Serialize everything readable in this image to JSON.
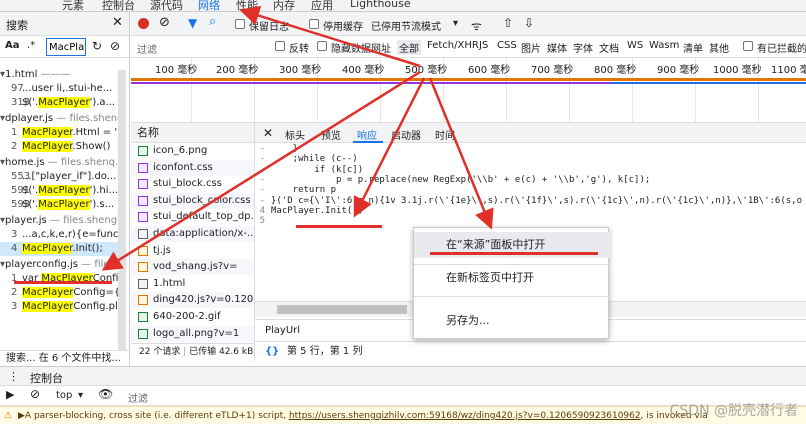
{
  "top_tabs": [
    "元素",
    "控制台",
    "源代码",
    "网络",
    "性能",
    "内存",
    "应用",
    "Lighthouse"
  ],
  "search": {
    "title": "搜索",
    "aa": "Aa",
    "regex": ".*",
    "query": "MacPlay",
    "results": [
      {
        "type": "file",
        "name": "1.html",
        "sub": "———"
      },
      {
        "type": "hit",
        "line": "97",
        "pre": "...user li,.stui-he..."
      },
      {
        "type": "hit",
        "line": "313",
        "pre": "$('.",
        "hl": "MacPlayer",
        "post": "').a..."
      },
      {
        "type": "file",
        "name": "dplayer.js",
        "sub": "— files.shenq..."
      },
      {
        "type": "hit",
        "line": "1",
        "hl": "MacPlayer",
        "post": ".Html = '..."
      },
      {
        "type": "hit",
        "line": "2",
        "hl": "MacPlayer",
        "post": ".Show()"
      },
      {
        "type": "file",
        "name": "home.js",
        "sub": "— files.shenq..."
      },
      {
        "type": "hit",
        "line": "553",
        "pre": "...[\"player_if\"].do..."
      },
      {
        "type": "hit",
        "line": "591",
        "pre": "$('.",
        "hl": "MacPlayer",
        "post": "').hi..."
      },
      {
        "type": "hit",
        "line": "593",
        "pre": "$('.",
        "hl": "MacPlayer",
        "post": "').s..."
      },
      {
        "type": "file",
        "name": "player.js",
        "sub": "— files.sheng..."
      },
      {
        "type": "hit",
        "line": "3",
        "pre": "...a,c,k,e,r){e=functi..."
      },
      {
        "type": "hit",
        "line": "4",
        "hl": "MacPlayer",
        "post": ".Init();",
        "selected": true
      },
      {
        "type": "file",
        "name": "playerconfig.js",
        "sub": "— files..."
      },
      {
        "type": "hit",
        "line": "1",
        "pre": "var ",
        "hl": "MacPlayer",
        "post": "Confi..."
      },
      {
        "type": "hit",
        "line": "2",
        "hl": "MacPlayer",
        "post": "Config={..."
      },
      {
        "type": "hit",
        "line": "3",
        "hl": "MacPlayer",
        "post": "Config.pl..."
      }
    ],
    "footer": "搜索...  在 6 个文件中找..."
  },
  "network_toolbar": {
    "preserve_log": "保留日志",
    "disable_cache": "停用缓存",
    "throttle": "已停用节流模式",
    "filter_placeholder": "过滤",
    "invert": "反转",
    "hide_data_urls": "隐藏数据网址",
    "types": [
      "全部",
      "Fetch/XHR",
      "JS",
      "CSS",
      "图片",
      "媒体",
      "字体",
      "文档",
      "WS",
      "Wasm",
      "清单",
      "其他"
    ],
    "blocked_cookies": "有已拦截的"
  },
  "timeline": {
    "ticks": [
      "100 毫秒",
      "200 毫秒",
      "300 毫秒",
      "400 毫秒",
      "500 毫秒",
      "600 毫秒",
      "700 毫秒",
      "800 毫秒",
      "900 毫秒",
      "1000 毫秒",
      "1100 毫"
    ]
  },
  "files": {
    "header": "名称",
    "items": [
      {
        "name": "icon_6.png",
        "kind": "img"
      },
      {
        "name": "iconfont.css",
        "kind": "css"
      },
      {
        "name": "stui_block.css",
        "kind": "css"
      },
      {
        "name": "stui_block_color.css",
        "kind": "css"
      },
      {
        "name": "stui_default_top_dp.css",
        "kind": "css"
      },
      {
        "name": "data:application/x-...",
        "kind": "doc"
      },
      {
        "name": "tj.js",
        "kind": "js"
      },
      {
        "name": "vod_shang.js?v=",
        "kind": "js"
      },
      {
        "name": "1.html",
        "kind": "doc"
      },
      {
        "name": "ding420.js?v=0.1206",
        "kind": "js"
      },
      {
        "name": "640-200-2.gif",
        "kind": "img"
      },
      {
        "name": "logo_all.png?v=1",
        "kind": "img"
      }
    ],
    "footer_requests": "22 个请求",
    "footer_transferred": "已传输 42.6 kB"
  },
  "detail_tabs": [
    "标头",
    "预览",
    "响应",
    "启动器",
    "时间"
  ],
  "code_lines": [
    {
      "g": "-",
      "text": "    }"
    },
    {
      "g": "-",
      "text": "    ;while (c--)"
    },
    {
      "g": "-",
      "text": "        if (k[c])"
    },
    {
      "g": "-",
      "text": "            p = p.replace(new RegExp('\\\\b' + e(c) + '\\\\b','g'), k[c]);"
    },
    {
      "g": "-",
      "text": "    return p"
    },
    {
      "g": "-",
      "text": "}('D c={\\'I\\':6(s,n){1v 3.1j.r(\\'{1e}\\',s).r(\\'{1f}\\',s).r(\\'{1c}\\',n).r(\\'{1c}\\',n)},\\'1B\\':6(s,o"
    },
    {
      "g": "4",
      "text": "MacPlayer.Init();"
    },
    {
      "g": "5",
      "text": ""
    }
  ],
  "code_filter": "PlayUrl",
  "status": {
    "braces": "{}",
    "position": "第 5 行，第 1 列"
  },
  "context_menu": [
    "在“来源”面板中打开",
    "在新标签页中打开",
    "另存为..."
  ],
  "drawer": {
    "tab": "控制台"
  },
  "console": {
    "context": "top",
    "filter_placeholder": "过滤"
  },
  "warning": {
    "prefix": "▶A parser-blocking, cross site (i.e. different eTLD+1) script, ",
    "link": "https://users.shengqizhilv.com:59168/wz/ding420.js?v=0.1206590923610962",
    "suffix": ", is invoked via"
  },
  "watermark": "CSDN @脱壳潜行者",
  "colors": {
    "accent": "#1a73e8",
    "highlight": "#ffff00",
    "annotation": "#e0302a"
  }
}
